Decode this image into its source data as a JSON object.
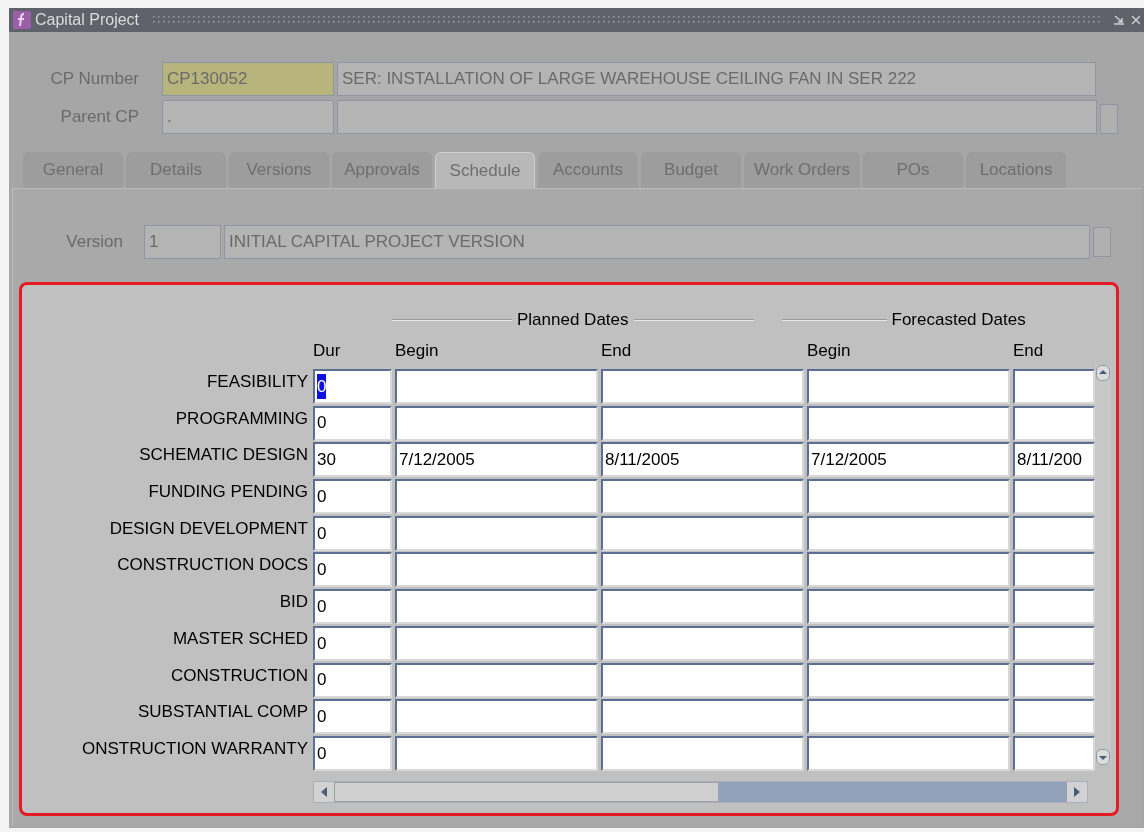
{
  "window": {
    "title": "Capital Project"
  },
  "header": {
    "cp_number_label": "CP Number",
    "cp_number": "CP130052",
    "cp_description": "SER: INSTALLATION OF LARGE WAREHOUSE CEILING FAN IN SER 222",
    "parent_cp_label": "Parent CP",
    "parent_cp": "."
  },
  "tabs": [
    {
      "label": "General",
      "selected": false
    },
    {
      "label": "Details",
      "selected": false
    },
    {
      "label": "Versions",
      "selected": false
    },
    {
      "label": "Approvals",
      "selected": false
    },
    {
      "label": "Schedule",
      "selected": true
    },
    {
      "label": "Accounts",
      "selected": false
    },
    {
      "label": "Budget",
      "selected": false
    },
    {
      "label": "Work Orders",
      "selected": false
    },
    {
      "label": "POs",
      "selected": false
    },
    {
      "label": "Locations",
      "selected": false
    }
  ],
  "version": {
    "label": "Version",
    "number": "1",
    "description": "INITIAL CAPITAL PROJECT VERSION"
  },
  "schedule": {
    "group_headers": [
      "Planned Dates",
      "Forecasted Dates"
    ],
    "columns": [
      "Dur",
      "Begin",
      "End",
      "Begin",
      "End"
    ],
    "rows": [
      {
        "label": "FEASIBILITY",
        "dur": "0",
        "selected": true
      },
      {
        "label": "PROGRAMMING",
        "dur": "0",
        "selected": false
      },
      {
        "label": "SCHEMATIC DESIGN",
        "dur": "30",
        "planned_begin": "7/12/2005",
        "planned_end": "8/11/2005",
        "forecast_begin": "7/12/2005",
        "forecast_end": "8/11/200",
        "selected": false
      },
      {
        "label": "FUNDING PENDING",
        "dur": "0",
        "selected": false
      },
      {
        "label": "DESIGN DEVELOPMENT",
        "dur": "0",
        "selected": false
      },
      {
        "label": "CONSTRUCTION DOCS",
        "dur": "0",
        "selected": false
      },
      {
        "label": "BID",
        "dur": "0",
        "selected": false
      },
      {
        "label": "MASTER SCHED",
        "dur": "0",
        "selected": false
      },
      {
        "label": "CONSTRUCTION",
        "dur": "0",
        "selected": false
      },
      {
        "label": "SUBSTANTIAL COMP",
        "dur": "0",
        "selected": false
      },
      {
        "label": "ONSTRUCTION WARRANTY",
        "dur": "0",
        "selected": false
      }
    ]
  }
}
